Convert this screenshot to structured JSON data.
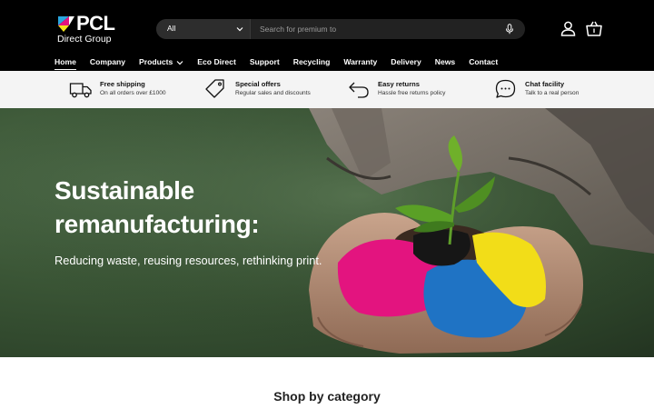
{
  "brand": {
    "name": "PCL",
    "subtitle": "Direct Group",
    "colors": {
      "cyan": "#2aa7df",
      "magenta": "#e3147f",
      "yellow": "#f4e31b",
      "black": "#000000"
    }
  },
  "search": {
    "category_value": "All",
    "placeholder": "Search for premium to",
    "icons": [
      "chevron-down-icon",
      "microphone-icon"
    ]
  },
  "header_icons": [
    "account-icon",
    "cart-icon"
  ],
  "nav": {
    "items": [
      {
        "label": "Home",
        "active": true
      },
      {
        "label": "Company"
      },
      {
        "label": "Products",
        "has_dropdown": true
      },
      {
        "label": "Eco Direct"
      },
      {
        "label": "Support"
      },
      {
        "label": "Recycling"
      },
      {
        "label": "Warranty"
      },
      {
        "label": "Delivery"
      },
      {
        "label": "News"
      },
      {
        "label": "Contact"
      }
    ]
  },
  "benefits": [
    {
      "icon": "delivery-truck-icon",
      "title": "Free shipping",
      "text": "On all orders over £1000"
    },
    {
      "icon": "price-tag-icon",
      "title": "Special offers",
      "text": "Regular sales and discounts"
    },
    {
      "icon": "return-arrow-icon",
      "title": "Easy returns",
      "text": "Hassle free returns policy"
    },
    {
      "icon": "chat-bubble-icon",
      "title": "Chat facility",
      "text": "Talk to a real person"
    }
  ],
  "hero": {
    "title": "Sustainable remanufacturing:",
    "subtitle": "Reducing waste, reusing resources, rethinking print."
  },
  "categories": {
    "title": "Shop by category"
  }
}
